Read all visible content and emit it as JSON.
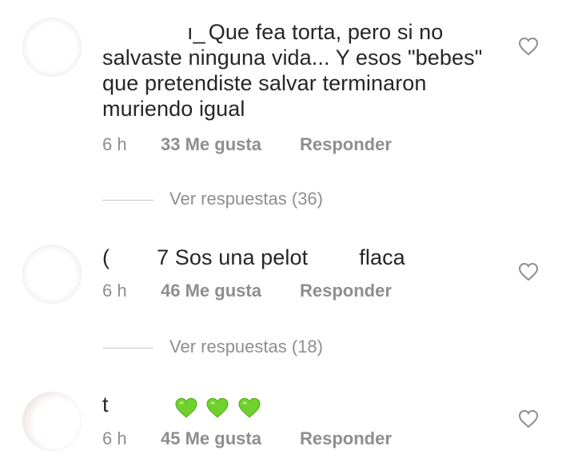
{
  "comments": [
    {
      "username": "ı_",
      "text": "Que fea torta, pero si no salvaste ninguna vida... Y esos \"bebes\" que pretendiste salvar terminaron muriendo igual",
      "time": "6 h",
      "likes": "33 Me gusta",
      "reply": "Responder",
      "view_replies": "Ver respuestas (36)"
    },
    {
      "username": "(",
      "text_a": "7 Sos una pelot",
      "text_b": "flaca",
      "time": "6 h",
      "likes": "46 Me gusta",
      "reply": "Responder",
      "view_replies": "Ver respuestas (18)"
    },
    {
      "username": "t",
      "emoji": "green-heart-emoji",
      "time": "6 h",
      "likes": "45 Me gusta",
      "reply": "Responder"
    }
  ],
  "icons": {
    "like": "heart-outline-icon",
    "emoji": "green-heart-icon"
  },
  "colors": {
    "text": "#262626",
    "secondary": "#8e8e8e",
    "divider": "#c7c7c7",
    "emoji_green": "#6fd12c"
  }
}
